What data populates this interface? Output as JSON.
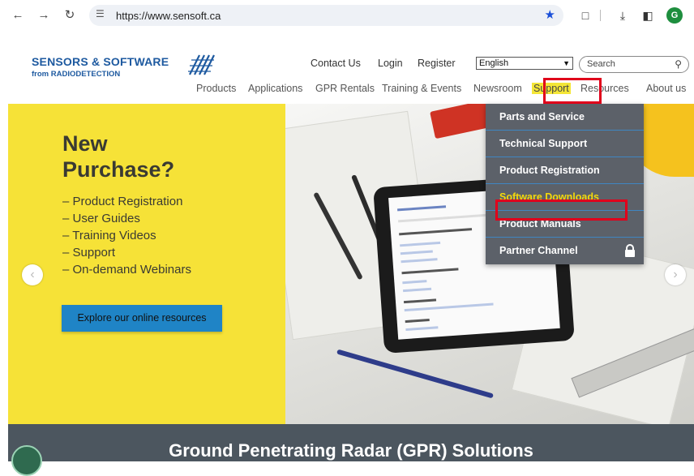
{
  "browser": {
    "url": "https://www.sensoft.ca",
    "profile_initial": "G",
    "accent": "#1a4fd8"
  },
  "header": {
    "logo_main": "SENSORS & SOFTWARE",
    "logo_sub": "from RADIODETECTION",
    "top_links": [
      "Contact Us",
      "Login",
      "Register"
    ],
    "language": "English",
    "search_placeholder": "Search",
    "nav": [
      "Products",
      "Applications",
      "GPR Rentals",
      "Training & Events",
      "Newsroom",
      "Support",
      "Resources",
      "About us"
    ],
    "brand_color": "#1e5aa0",
    "highlight_color": "#f4e637"
  },
  "hero": {
    "title_line1": "New",
    "title_line2": "Purchase?",
    "items": [
      "– Product Registration",
      "– User Guides",
      "– Training Videos",
      "– Support",
      "– On-demand Webinars"
    ],
    "cta": "Explore our online resources",
    "background": "#f6e237",
    "prev_icon": "chevron-left-icon",
    "next_icon": "chevron-right-icon"
  },
  "support_menu": {
    "items": [
      {
        "label": "Parts and Service"
      },
      {
        "label": "Technical Support"
      },
      {
        "label": "Product Registration"
      },
      {
        "label": "Software Downloads"
      },
      {
        "label": "Product Manuals"
      },
      {
        "label": "Partner Channel"
      }
    ],
    "background": "#5c6169",
    "highlight_label_color": "#f5d90a"
  },
  "footer": {
    "title": "Ground Penetrating Radar (GPR) Solutions"
  }
}
